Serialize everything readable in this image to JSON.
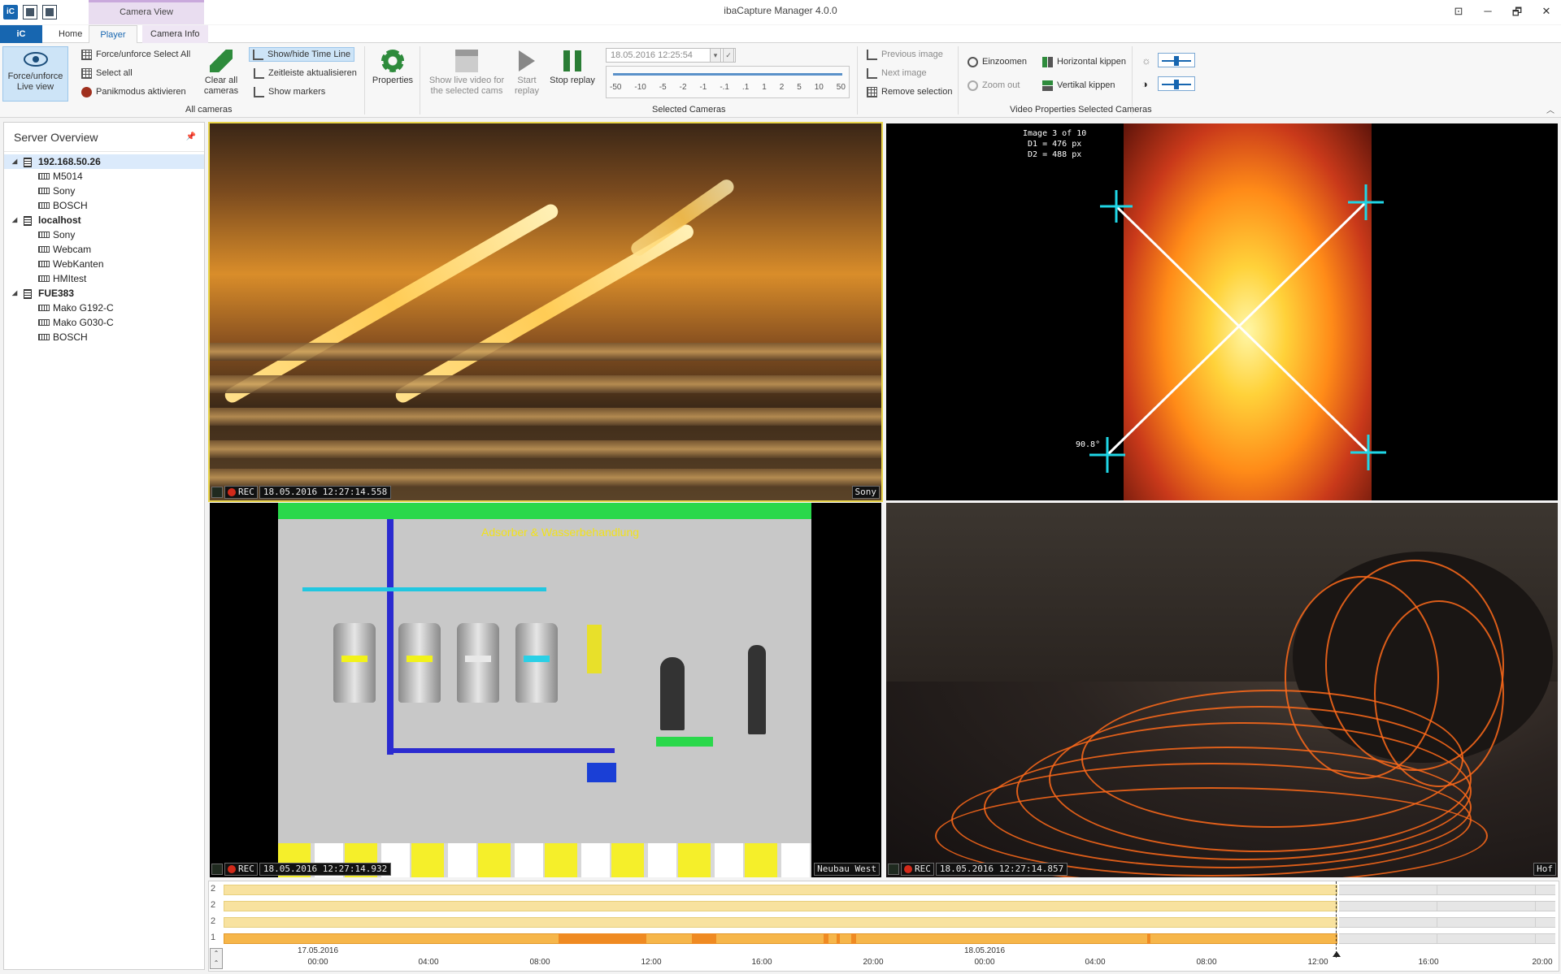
{
  "window": {
    "title": "ibaCapture Manager 4.0.0",
    "context_tab_header": "Camera View",
    "logo_text": "iC",
    "controls": [
      "⊡",
      "─",
      "🗗",
      "✕"
    ]
  },
  "tabs": [
    {
      "label": "iC"
    },
    {
      "label": "Home"
    },
    {
      "label": "Player"
    },
    {
      "label": "Camera Info"
    }
  ],
  "ribbon": {
    "force_unforce": "Force/unforce Live view",
    "force_unforce_select_all": "Force/unforce Select All",
    "select_all": "Select all",
    "panic_mode": "Panikmodus aktivieren",
    "clear_all_cameras": "Clear all cameras",
    "show_hide_timeline": "Show/hide Time Line",
    "update_timeline": "Zeitleiste aktualisieren",
    "show_markers": "Show markers",
    "properties": "Properties",
    "show_live_video": "Show live video for the selected cams",
    "start_replay": "Start replay",
    "stop_replay": "Stop replay",
    "datetime_value": "18.05.2016 12:25:54",
    "speed_ticks": [
      "-50",
      "-10",
      "-5",
      "-2",
      "-1",
      "-.1",
      ".1",
      "1",
      "2",
      "5",
      "10",
      "50"
    ],
    "previous_image": "Previous image",
    "next_image": "Next image",
    "remove_selection": "Remove selection",
    "zoom_in": "Einzoomen",
    "zoom_out": "Zoom out",
    "flip_horizontal": "Horizontal kippen",
    "flip_vertical": "Vertikal kippen",
    "group_all_cameras": "All cameras",
    "group_selected_cameras": "Selected Cameras",
    "group_video_properties": "Video Properties Selected Cameras"
  },
  "sidebar": {
    "title": "Server Overview",
    "servers": [
      {
        "name": "192.168.50.26",
        "cameras": [
          "M5014",
          "Sony",
          "BOSCH"
        ]
      },
      {
        "name": "localhost",
        "cameras": [
          "Sony",
          "Webcam",
          "WebKanten",
          "HMItest"
        ]
      },
      {
        "name": "FUE383",
        "cameras": [
          "Mako G192-C",
          "Mako G030-C",
          "BOSCH"
        ]
      }
    ]
  },
  "tiles": [
    {
      "rec": "REC",
      "timestamp": "18.05.2016 12:27:14.558",
      "camera": "Sony"
    },
    {
      "measure": "Image 3 of 10\n D1 = 476 px\n D2 = 488 px",
      "angle": "90.8°"
    },
    {
      "rec": "REC",
      "timestamp": "18.05.2016 12:27:14.932",
      "camera": "Neubau West",
      "hmi_title": "Adsorber & Wasserbehandlung"
    },
    {
      "rec": "REC",
      "timestamp": "18.05.2016 12:27:14.857",
      "camera": "Hof"
    }
  ],
  "timeline": {
    "rows": [
      "2",
      "2",
      "2",
      "1"
    ],
    "dates": [
      {
        "label": "17.05.2016"
      },
      {
        "label": "18.05.2016"
      }
    ],
    "hours": [
      "00:00",
      "04:00",
      "08:00",
      "12:00",
      "16:00",
      "20:00",
      "00:00",
      "04:00",
      "08:00",
      "12:00",
      "16:00",
      "20:00"
    ]
  },
  "colors": {
    "accent": "#1766b0",
    "selected_tile_border": "#e8d44a",
    "timeline_bar": "#f8e29f",
    "timeline_marker": "#ef8a22"
  }
}
